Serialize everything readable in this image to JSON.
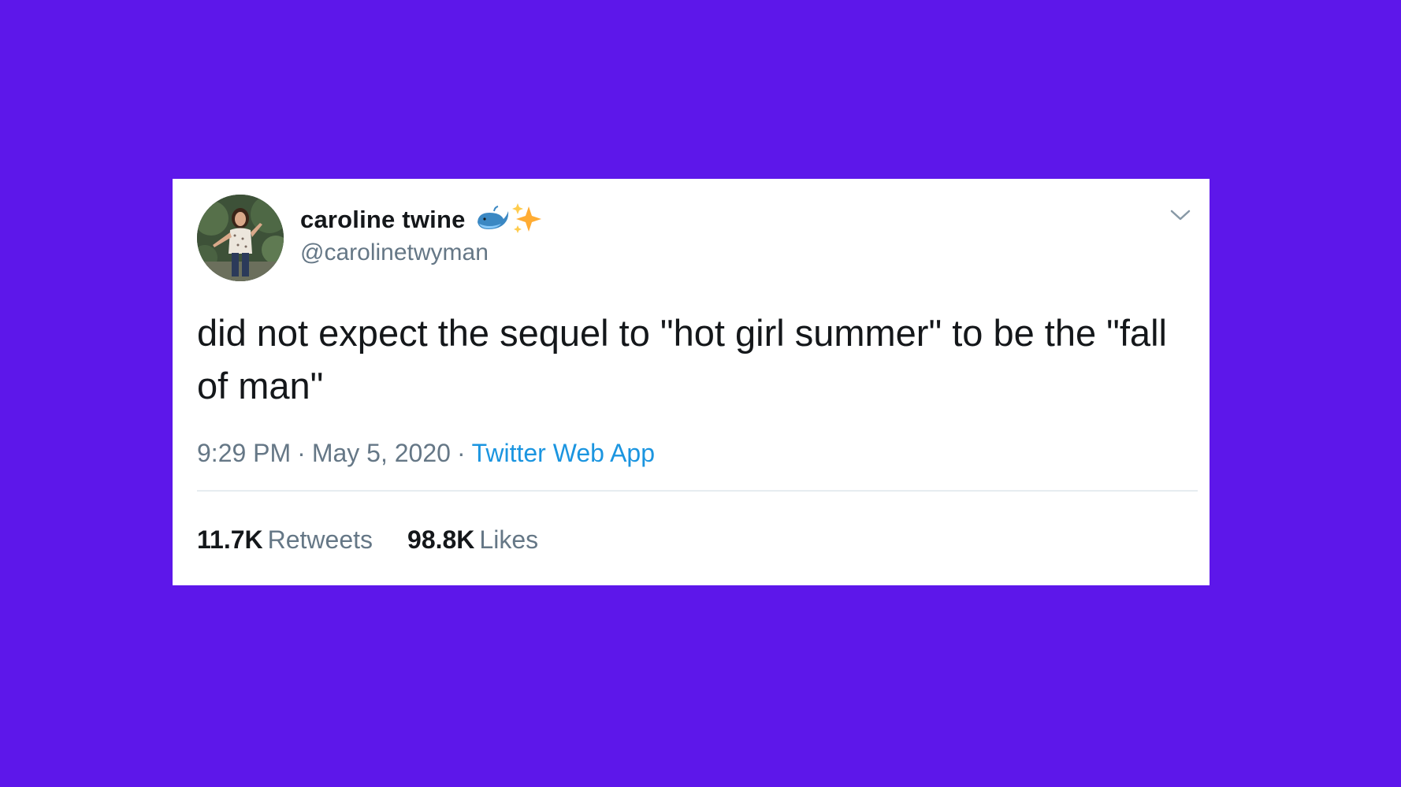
{
  "colors": {
    "background": "#5d17ea",
    "card": "#ffffff",
    "text_primary": "#14171a",
    "text_secondary": "#657786",
    "link": "#1b95e0",
    "divider": "#e6ecf0"
  },
  "tweet": {
    "author": {
      "display_name": "caroline twine",
      "name_emojis": [
        "whale-emoji",
        "sparkles-emoji"
      ],
      "handle": "@carolinetwyman",
      "avatar": "profile-photo"
    },
    "menu_icon": "chevron-down-icon",
    "text": "did not expect the sequel to \"hot girl summer\" to be the \"fall of man\"",
    "time": "9:29 PM",
    "date": "May 5, 2020",
    "separator": "·",
    "source": "Twitter Web App",
    "stats": {
      "retweets_count": "11.7K",
      "retweets_label": "Retweets",
      "likes_count": "98.8K",
      "likes_label": "Likes"
    }
  }
}
